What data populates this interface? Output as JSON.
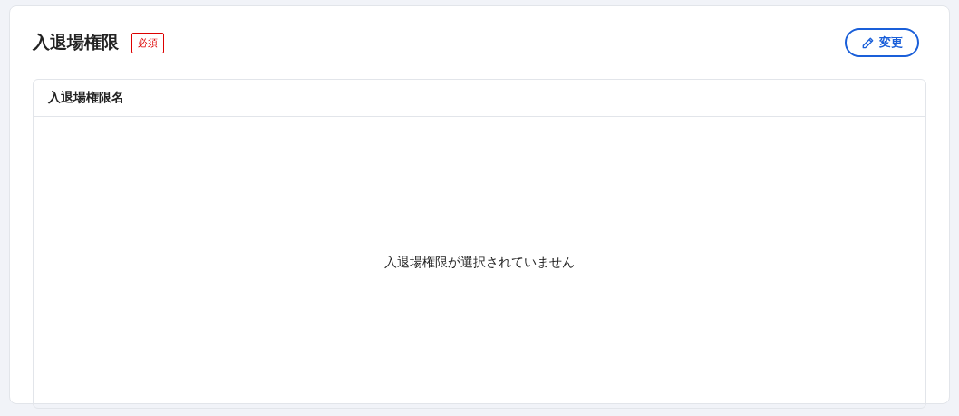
{
  "section": {
    "title": "入退場権限",
    "required_badge": "必須",
    "edit_button": "変更"
  },
  "table": {
    "columns": [
      "入退場権限名"
    ],
    "empty_message": "入退場権限が選択されていません"
  }
}
